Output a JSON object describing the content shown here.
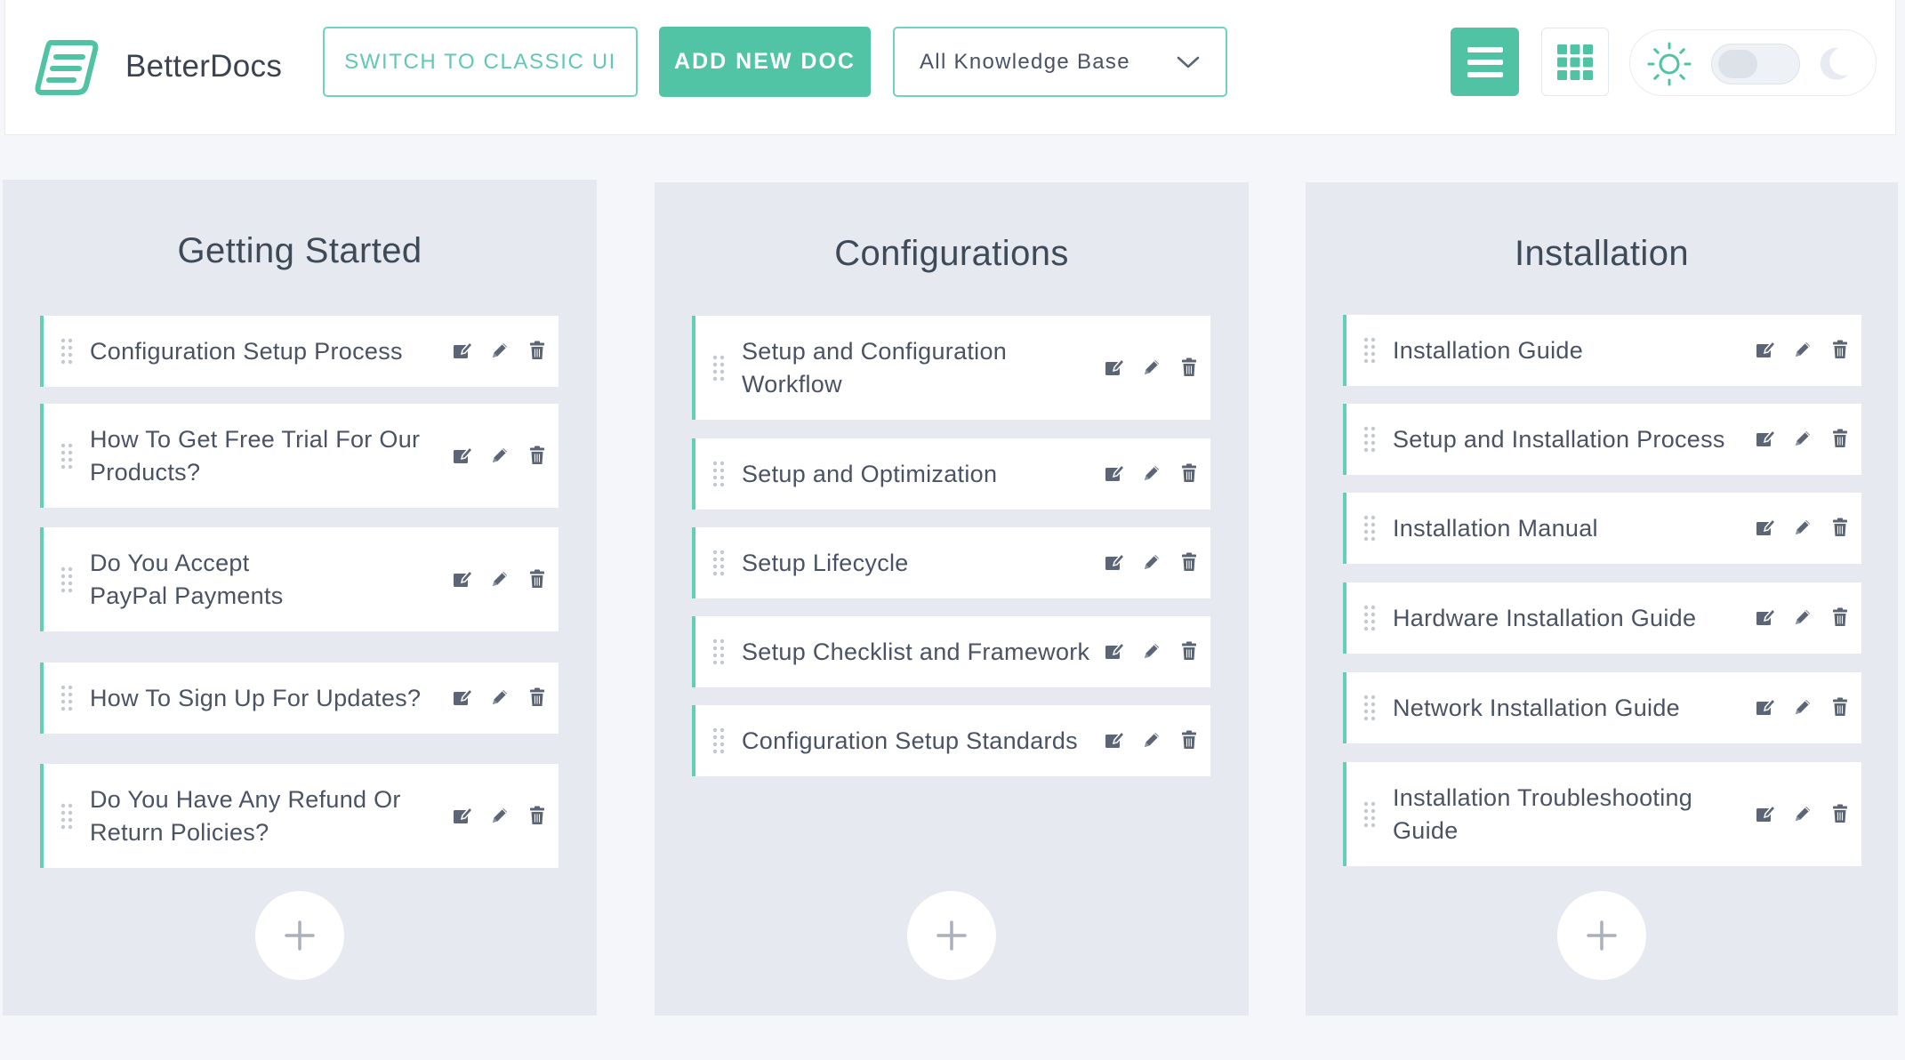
{
  "header": {
    "brand_name": "BetterDocs",
    "switch_classic_label": "SWITCH TO CLASSIC UI",
    "add_new_doc_label": "ADD NEW DOC",
    "kb_select_value": "All Knowledge Base"
  },
  "colors": {
    "accent": "#52c4a6",
    "accent_border": "#6fd2c2",
    "column_bg": "#e6e9f0",
    "page_bg": "#f4f6fa",
    "text": "#3f4a59"
  },
  "icons": {
    "logo": "betterdocs-logo-icon",
    "list_view": "list-view-icon",
    "grid_view": "grid-view-icon",
    "light_mode": "sun-icon",
    "dark_mode": "moon-icon",
    "drag": "drag-handle-icon",
    "quick_edit": "quick-edit-icon",
    "edit": "pencil-icon",
    "delete": "trash-icon",
    "add": "plus-icon"
  },
  "columns": [
    {
      "title": "Getting Started",
      "docs": [
        "Configuration Setup Process",
        "How To Get Free Trial For Our Products?",
        "Do You Accept PayPal Payments",
        "How To Sign Up For Updates?",
        "Do You Have Any Refund Or Return Policies?"
      ]
    },
    {
      "title": "Configurations",
      "docs": [
        "Setup and Configuration Workflow",
        "Setup and Optimization",
        "Setup Lifecycle",
        "Setup Checklist and Framework",
        "Configuration Setup Standards"
      ]
    },
    {
      "title": "Installation",
      "docs": [
        "Installation Guide",
        "Setup and Installation Process",
        "Installation Manual",
        "Hardware Installation Guide",
        "Network Installation Guide",
        "Installation Troubleshooting Guide"
      ]
    }
  ]
}
